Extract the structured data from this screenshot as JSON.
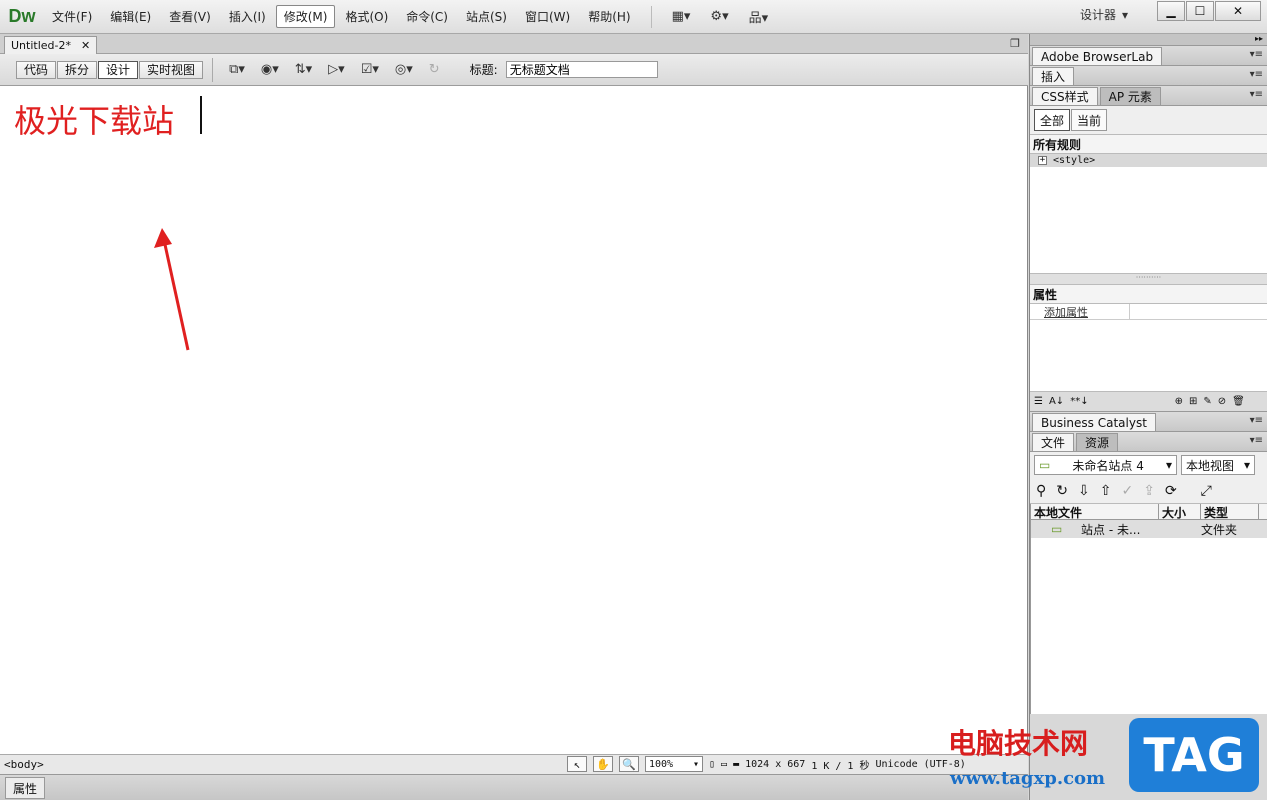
{
  "app": {
    "logo": "Dw"
  },
  "menu": {
    "items": [
      "文件(F)",
      "编辑(E)",
      "查看(V)",
      "插入(I)",
      "修改(M)",
      "格式(O)",
      "命令(C)",
      "站点(S)",
      "窗口(W)",
      "帮助(H)"
    ],
    "active_index": 4,
    "workspace_label": "设计器"
  },
  "document": {
    "tab_title": "Untitled-2*",
    "view_buttons": [
      "代码",
      "拆分",
      "设计",
      "实时视图"
    ],
    "active_view_index": 2,
    "title_label": "标题:",
    "title_value": "无标题文档",
    "canvas_text": "极光下载站"
  },
  "status": {
    "tag_selector": "<body>",
    "zoom": "100%",
    "window_size": "1024 x 667",
    "download": "1 K / 1 秒",
    "encoding": "Unicode (UTF-8)"
  },
  "bottom_panel": {
    "tab": "属性"
  },
  "right_panel": {
    "browserlab": "Adobe BrowserLab",
    "insert": "插入",
    "css_tabs": [
      "CSS样式",
      "AP 元素"
    ],
    "css_modes": [
      "全部",
      "当前"
    ],
    "all_rules_title": "所有规则",
    "rule_item": "<style>",
    "properties_title": "属性",
    "add_property": "添加属性",
    "business_catalyst": "Business Catalyst",
    "files_tabs": [
      "文件",
      "资源"
    ],
    "site_select": "未命名站点 4",
    "view_select": "本地视图",
    "columns": [
      "本地文件",
      "大小",
      "类型"
    ],
    "file_row": {
      "name": "站点 - 未...",
      "type": "文件夹"
    }
  },
  "watermark": {
    "text": "电脑技术网",
    "url": "www.tagxp.com",
    "badge": "TAG"
  },
  "colors": {
    "canvas_text": "#e02020",
    "arrow": "#e02020",
    "logo": "#2a7a2a"
  }
}
